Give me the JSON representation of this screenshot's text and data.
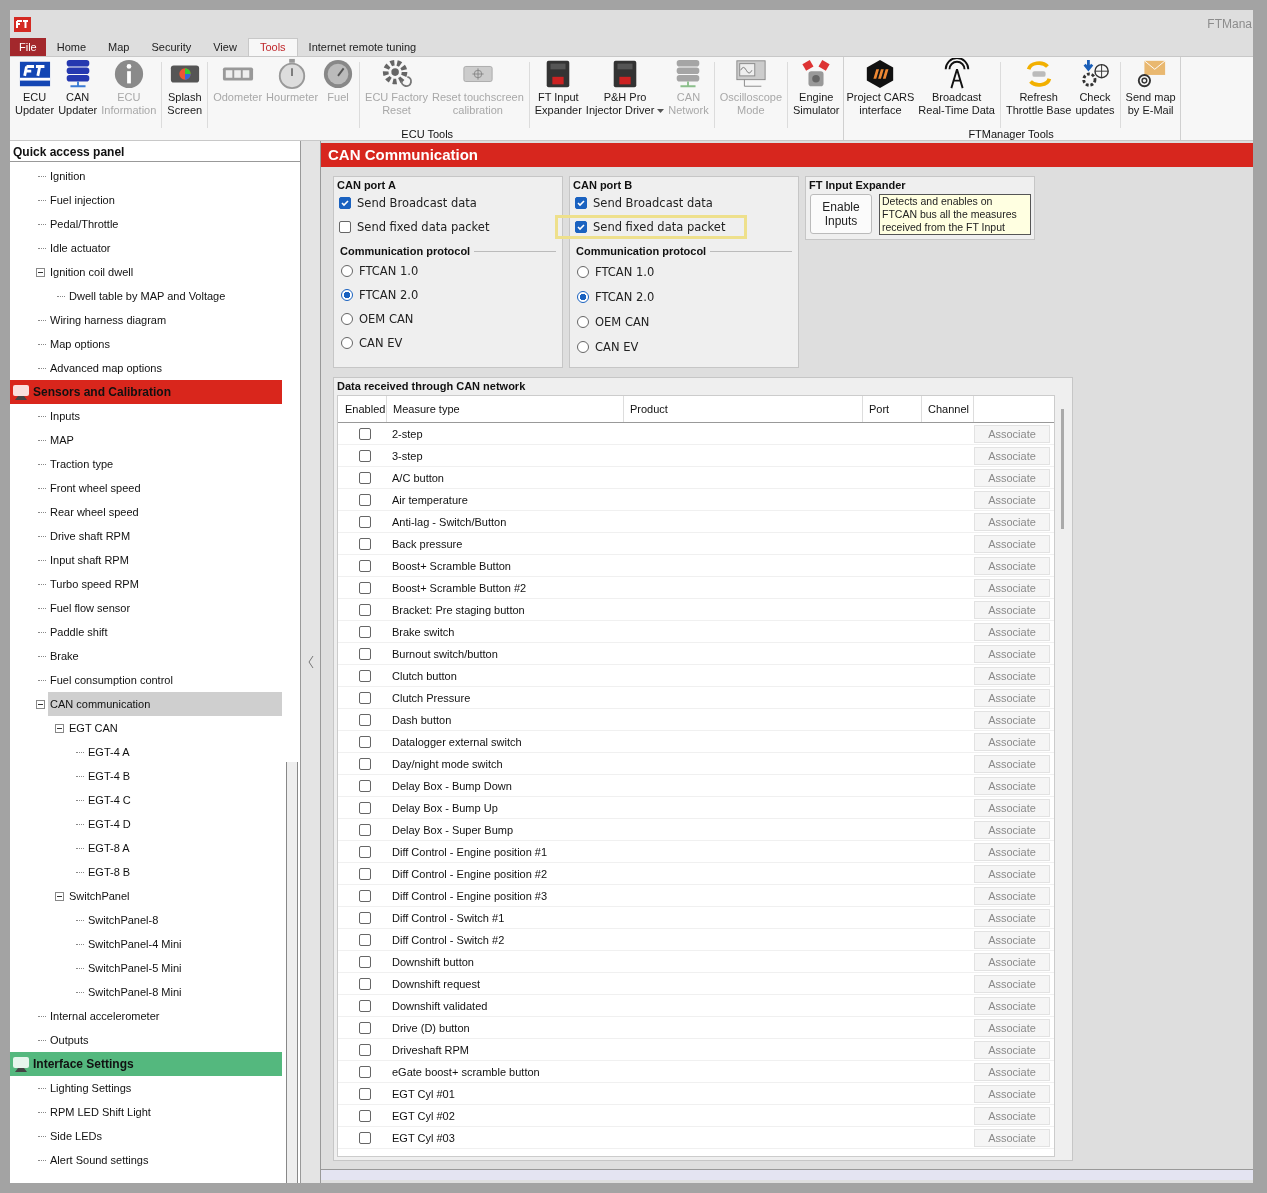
{
  "window": {
    "title": "FTMana"
  },
  "menu_tabs": [
    {
      "label": "File",
      "kind": "file",
      "selected": false
    },
    {
      "label": "Home",
      "kind": "tab",
      "selected": false
    },
    {
      "label": "Map",
      "kind": "tab",
      "selected": false
    },
    {
      "label": "Security",
      "kind": "tab",
      "selected": false
    },
    {
      "label": "View",
      "kind": "tab",
      "selected": false
    },
    {
      "label": "Tools",
      "kind": "tab",
      "selected": true
    },
    {
      "label": "Internet remote tuning",
      "kind": "tab",
      "selected": false
    }
  ],
  "ribbon": [
    {
      "label": "ECU Tools",
      "clusters": [
        [
          {
            "lines": [
              "ECU",
              "Updater"
            ],
            "kind": "ft-logo",
            "disabled": false,
            "dropdown": false
          },
          {
            "lines": [
              "CAN",
              "Updater"
            ],
            "kind": "server",
            "disabled": false,
            "dropdown": false
          },
          {
            "lines": [
              "ECU",
              "Information"
            ],
            "kind": "info",
            "disabled": true,
            "dropdown": false
          }
        ],
        [
          {
            "lines": [
              "Splash",
              "Screen"
            ],
            "kind": "screen",
            "disabled": false,
            "dropdown": false
          }
        ],
        [
          {
            "lines": [
              "Odometer"
            ],
            "kind": "counter",
            "disabled": true,
            "dropdown": false
          },
          {
            "lines": [
              "Hourmeter"
            ],
            "kind": "stopwatch",
            "disabled": true,
            "dropdown": false
          },
          {
            "lines": [
              "Fuel"
            ],
            "kind": "gauge",
            "disabled": true,
            "dropdown": false
          }
        ],
        [
          {
            "lines": [
              "ECU Factory",
              "Reset"
            ],
            "kind": "gear",
            "disabled": true,
            "dropdown": false
          },
          {
            "lines": [
              "Reset touchscreen",
              "calibration"
            ],
            "kind": "touchscreen",
            "disabled": true,
            "dropdown": false
          }
        ],
        [
          {
            "lines": [
              "FT Input",
              "Expander"
            ],
            "kind": "module",
            "disabled": false,
            "dropdown": false
          },
          {
            "lines": [
              "P&H Pro",
              "Injector Driver"
            ],
            "kind": "module",
            "disabled": false,
            "dropdown": true
          },
          {
            "lines": [
              "CAN",
              "Network"
            ],
            "kind": "server",
            "disabled": true,
            "dropdown": false
          }
        ],
        [
          {
            "lines": [
              "Oscilloscope",
              "Mode"
            ],
            "kind": "oscilloscope",
            "disabled": true,
            "dropdown": false
          }
        ],
        [
          {
            "lines": [
              "Engine",
              "Simulator"
            ],
            "kind": "engine",
            "disabled": false,
            "dropdown": false
          }
        ]
      ]
    },
    {
      "label": "FTManager Tools",
      "clusters": [
        [
          {
            "lines": [
              "Project CARS",
              "interface"
            ],
            "kind": "hexagon",
            "disabled": false,
            "dropdown": false
          },
          {
            "lines": [
              "Broadcast",
              "Real-Time Data"
            ],
            "kind": "antenna",
            "disabled": false,
            "dropdown": false
          }
        ],
        [
          {
            "lines": [
              "Refresh",
              "Throttle Base"
            ],
            "kind": "refresh",
            "disabled": false,
            "dropdown": false
          },
          {
            "lines": [
              "Check",
              "updates"
            ],
            "kind": "download",
            "disabled": false,
            "dropdown": false
          }
        ],
        [
          {
            "lines": [
              "Send map",
              "by E-Mail"
            ],
            "kind": "mail",
            "disabled": false,
            "dropdown": false
          }
        ]
      ]
    }
  ],
  "sidebar": {
    "title": "Quick access panel",
    "groups": [
      {
        "items": [
          {
            "label": "Ignition",
            "selected": false
          },
          {
            "label": "Fuel injection",
            "selected": false
          },
          {
            "label": "Pedal/Throttle",
            "selected": false
          },
          {
            "label": "Idle actuator",
            "selected": false
          },
          {
            "label": "Ignition coil dwell",
            "selected": false,
            "expanded": true,
            "children": [
              {
                "label": "Dwell table by MAP and Voltage",
                "selected": false
              }
            ]
          },
          {
            "label": "Wiring harness diagram",
            "selected": false
          },
          {
            "label": "Map options",
            "selected": false
          },
          {
            "label": "Advanced map options",
            "selected": false
          }
        ]
      },
      {
        "label": "Sensors and Calibration",
        "color": "#d9261c",
        "items": [
          {
            "label": "Inputs",
            "selected": false
          },
          {
            "label": "MAP",
            "selected": false
          },
          {
            "label": "Traction type",
            "selected": false
          },
          {
            "label": "Front wheel speed",
            "selected": false
          },
          {
            "label": "Rear wheel speed",
            "selected": false
          },
          {
            "label": "Drive shaft RPM",
            "selected": false
          },
          {
            "label": "Input shaft RPM",
            "selected": false
          },
          {
            "label": "Turbo speed RPM",
            "selected": false
          },
          {
            "label": "Fuel flow sensor",
            "selected": false
          },
          {
            "label": "Paddle shift",
            "selected": false
          },
          {
            "label": "Brake",
            "selected": false
          },
          {
            "label": "Fuel consumption control",
            "selected": false
          },
          {
            "label": "CAN communication",
            "selected": true,
            "expanded": true,
            "children": [
              {
                "label": "EGT CAN",
                "selected": false,
                "expanded": true,
                "children": [
                  {
                    "label": "EGT-4 A",
                    "selected": false
                  },
                  {
                    "label": "EGT-4 B",
                    "selected": false
                  },
                  {
                    "label": "EGT-4 C",
                    "selected": false
                  },
                  {
                    "label": "EGT-4 D",
                    "selected": false
                  },
                  {
                    "label": "EGT-8 A",
                    "selected": false
                  },
                  {
                    "label": "EGT-8 B",
                    "selected": false
                  }
                ]
              },
              {
                "label": "SwitchPanel",
                "selected": false,
                "expanded": true,
                "children": [
                  {
                    "label": "SwitchPanel-8",
                    "selected": false
                  },
                  {
                    "label": "SwitchPanel-4 Mini",
                    "selected": false
                  },
                  {
                    "label": "SwitchPanel-5 Mini",
                    "selected": false
                  },
                  {
                    "label": "SwitchPanel-8 Mini",
                    "selected": false
                  }
                ]
              }
            ]
          },
          {
            "label": "Internal accelerometer",
            "selected": false
          },
          {
            "label": "Outputs",
            "selected": false
          }
        ]
      },
      {
        "label": "Interface Settings",
        "color": "#54b87e",
        "items": [
          {
            "label": "Lighting Settings",
            "selected": false
          },
          {
            "label": "RPM LED Shift Light",
            "selected": false
          },
          {
            "label": "Side LEDs",
            "selected": false
          },
          {
            "label": "Alert Sound settings",
            "selected": false
          }
        ]
      }
    ]
  },
  "panel": {
    "title": "CAN Communication",
    "ports": [
      {
        "title": "CAN port A",
        "options": [
          {
            "label": "Send Broadcast data",
            "checked": true,
            "highlighted": false
          },
          {
            "label": "Send fixed data packet",
            "checked": false,
            "highlighted": false
          }
        ],
        "protocol_title": "Communication protocol",
        "protocols": [
          {
            "label": "FTCAN 1.0",
            "selected": false
          },
          {
            "label": "FTCAN 2.0",
            "selected": true
          },
          {
            "label": "OEM CAN",
            "selected": false
          },
          {
            "label": "CAN EV",
            "selected": false
          }
        ]
      },
      {
        "title": "CAN port B",
        "options": [
          {
            "label": "Send Broadcast data",
            "checked": true,
            "highlighted": false
          },
          {
            "label": "Send fixed data packet",
            "checked": true,
            "highlighted": true
          }
        ],
        "protocol_title": "Communication protocol",
        "protocols": [
          {
            "label": "FTCAN 1.0",
            "selected": false
          },
          {
            "label": "FTCAN 2.0",
            "selected": true
          },
          {
            "label": "OEM CAN",
            "selected": false
          },
          {
            "label": "CAN EV",
            "selected": false
          }
        ]
      }
    ],
    "expander": {
      "title": "FT Input Expander",
      "button": [
        "Enable",
        "Inputs"
      ],
      "tooltip": "Detects and enables on FTCAN bus all the measures received from the FT Input"
    },
    "table": {
      "title": "Data received through CAN network",
      "columns": [
        "Enabled",
        "Measure type",
        "Product",
        "Port",
        "Channel"
      ],
      "rows": [
        {
          "enabled": false,
          "measure": "2-step",
          "action": "Associate"
        },
        {
          "enabled": false,
          "measure": "3-step",
          "action": "Associate"
        },
        {
          "enabled": false,
          "measure": "A/C button",
          "action": "Associate"
        },
        {
          "enabled": false,
          "measure": "Air temperature",
          "action": "Associate"
        },
        {
          "enabled": false,
          "measure": "Anti-lag - Switch/Button",
          "action": "Associate"
        },
        {
          "enabled": false,
          "measure": "Back pressure",
          "action": "Associate"
        },
        {
          "enabled": false,
          "measure": "Boost+ Scramble Button",
          "action": "Associate"
        },
        {
          "enabled": false,
          "measure": "Boost+ Scramble Button #2",
          "action": "Associate"
        },
        {
          "enabled": false,
          "measure": "Bracket: Pre staging button",
          "action": "Associate"
        },
        {
          "enabled": false,
          "measure": "Brake switch",
          "action": "Associate"
        },
        {
          "enabled": false,
          "measure": "Burnout switch/button",
          "action": "Associate"
        },
        {
          "enabled": false,
          "measure": "Clutch button",
          "action": "Associate"
        },
        {
          "enabled": false,
          "measure": "Clutch Pressure",
          "action": "Associate"
        },
        {
          "enabled": false,
          "measure": "Dash button",
          "action": "Associate"
        },
        {
          "enabled": false,
          "measure": "Datalogger external switch",
          "action": "Associate"
        },
        {
          "enabled": false,
          "measure": "Day/night mode switch",
          "action": "Associate"
        },
        {
          "enabled": false,
          "measure": "Delay Box - Bump Down",
          "action": "Associate"
        },
        {
          "enabled": false,
          "measure": "Delay Box - Bump Up",
          "action": "Associate"
        },
        {
          "enabled": false,
          "measure": "Delay Box - Super Bump",
          "action": "Associate"
        },
        {
          "enabled": false,
          "measure": "Diff Control - Engine position #1",
          "action": "Associate"
        },
        {
          "enabled": false,
          "measure": "Diff Control - Engine position #2",
          "action": "Associate"
        },
        {
          "enabled": false,
          "measure": "Diff Control - Engine position #3",
          "action": "Associate"
        },
        {
          "enabled": false,
          "measure": "Diff Control - Switch #1",
          "action": "Associate"
        },
        {
          "enabled": false,
          "measure": "Diff Control - Switch #2",
          "action": "Associate"
        },
        {
          "enabled": false,
          "measure": "Downshift button",
          "action": "Associate"
        },
        {
          "enabled": false,
          "measure": "Downshift request",
          "action": "Associate"
        },
        {
          "enabled": false,
          "measure": "Downshift validated",
          "action": "Associate"
        },
        {
          "enabled": false,
          "measure": "Drive (D) button",
          "action": "Associate"
        },
        {
          "enabled": false,
          "measure": "Driveshaft RPM",
          "action": "Associate"
        },
        {
          "enabled": false,
          "measure": "eGate boost+ scramble button",
          "action": "Associate"
        },
        {
          "enabled": false,
          "measure": "EGT Cyl #01",
          "action": "Associate"
        },
        {
          "enabled": false,
          "measure": "EGT Cyl #02",
          "action": "Associate"
        },
        {
          "enabled": false,
          "measure": "EGT Cyl #03",
          "action": "Associate"
        }
      ]
    }
  }
}
